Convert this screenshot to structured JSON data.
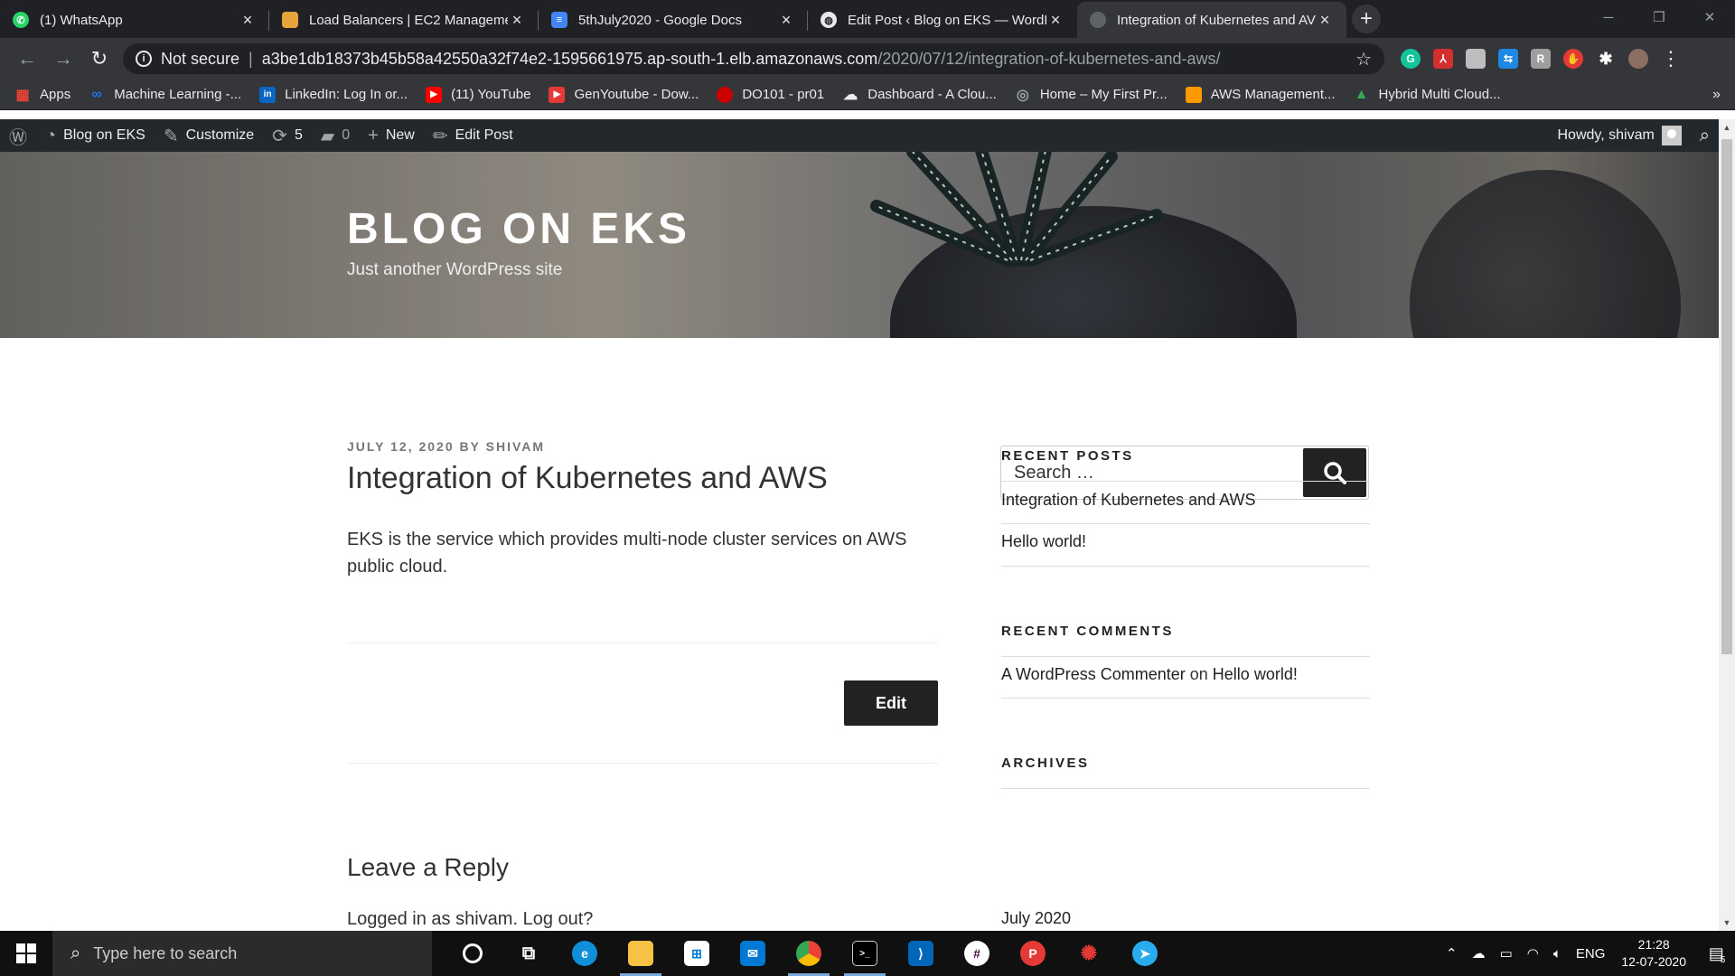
{
  "browser": {
    "tabs": [
      {
        "title": "(1) WhatsApp",
        "favicon_color": "#25D366",
        "active": false
      },
      {
        "title": "Load Balancers | EC2 Managemen",
        "favicon_color": "#E8A33D",
        "active": false
      },
      {
        "title": "5thJuly2020 - Google Docs",
        "favicon_color": "#4285F4",
        "active": false
      },
      {
        "title": "Edit Post ‹ Blog on EKS — WordP",
        "favicon_color": "#9aa0a6",
        "active": false
      },
      {
        "title": "Integration of Kubernetes and AV",
        "favicon_color": "#5f6368",
        "active": true
      }
    ],
    "address": {
      "security": "Not secure",
      "host": "a3be1db18373b45b58a42550a32f74e2-1595661975.ap-south-1.elb.amazonaws.com",
      "path": "/2020/07/12/integration-of-kubernetes-and-aws/"
    },
    "bookmarks": [
      {
        "label": "Apps",
        "color": "#EA4335"
      },
      {
        "label": "Machine Learning -...",
        "color": "#1a73e8"
      },
      {
        "label": "LinkedIn: Log In or...",
        "color": "#0A66C2"
      },
      {
        "label": "(11) YouTube",
        "color": "#FF0000"
      },
      {
        "label": "GenYoutube - Dow...",
        "color": "#E53935"
      },
      {
        "label": "DO101 - pr01",
        "color": "#CC0000"
      },
      {
        "label": "Dashboard - A Clou...",
        "color": "#eeeeee"
      },
      {
        "label": "Home – My First Pr...",
        "color": "#777777"
      },
      {
        "label": "AWS Management...",
        "color": "#FF9900"
      },
      {
        "label": "Hybrid Multi Cloud...",
        "color": "#34A853"
      }
    ]
  },
  "adminbar": {
    "site_name": "Blog on EKS",
    "customize": "Customize",
    "updates": "5",
    "comments": "0",
    "new": "New",
    "edit_post": "Edit Post",
    "howdy": "Howdy, shivam"
  },
  "site": {
    "title": "Blog on EKS",
    "description": "Just another WordPress site"
  },
  "post": {
    "date": "July 12, 2020",
    "by": "by",
    "author": "Shivam",
    "title": "Integration of Kubernetes and AWS",
    "body": "EKS is the service which provides multi-node cluster services on AWS public cloud.",
    "edit_label": "Edit"
  },
  "reply": {
    "title": "Leave a Reply",
    "logged_in_prefix": "Logged in as shivam.",
    "logout": "Log out?"
  },
  "sidebar": {
    "search_placeholder": "Search …",
    "recent_posts_title": "Recent Posts",
    "recent_posts": [
      "Integration of Kubernetes and AWS",
      "Hello world!"
    ],
    "recent_comments_title": "Recent Comments",
    "comment_author": "A WordPress Commenter",
    "comment_on": "on",
    "comment_post": "Hello world!",
    "archives_title": "Archives",
    "archives": [
      "July 2020"
    ]
  },
  "taskbar": {
    "search_placeholder": "Type here to search",
    "language": "ENG",
    "time": "21:28",
    "date": "12-07-2020",
    "notifications": "5"
  }
}
